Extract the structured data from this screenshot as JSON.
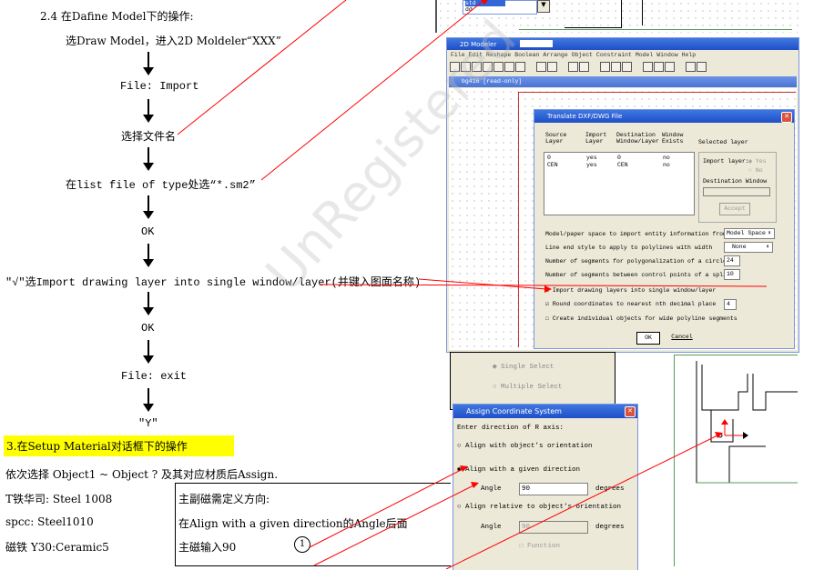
{
  "doc": {
    "section_24_title": "2.4 在Dafine Model下的操作:",
    "flow": [
      "选Draw Model，进入2D Moldeler“XXX”",
      "File: Import",
      "选择文件名",
      "在list file of type处选“*.sm2”",
      "OK",
      "\"√\"选Import drawing layer into single window/layer(并键入图面名称)",
      "OK",
      "File: exit",
      "\"Y\""
    ],
    "section_3_title": "3.在Setup Material对话框下的操作",
    "select_line": "依次选择  Object1  ~  Object ? 及其对应材质后Assign.",
    "materials": [
      "T铁华司: Steel 1008",
      "spcc: Steel1010",
      "磁铁 Y30:Ceramic5"
    ],
    "note_box": [
      "主副磁需定义方向:",
      "在Align with a given direction的Angle后面",
      "主磁输入90"
    ],
    "note_circle": "1",
    "watermark": "UnRegistered"
  },
  "screens": {
    "top_strip": {
      "dd_item1": "std",
      "dd_item2": "dd"
    },
    "modeler": {
      "title": "2D Modeler",
      "menu": "File Edit Reshape Boolean Arrange Object Constraint Model Window Help",
      "doc_tab": "bg416 [read-only]"
    },
    "dxf_dialog": {
      "title": "Translate DXF/DWG File",
      "headers": [
        "Source Layer",
        "Import Layer",
        "Destination Window/Layer",
        "Window Exists",
        "Selected layer"
      ],
      "rows": [
        [
          "0",
          "yes",
          "0",
          "no"
        ],
        [
          "CEN",
          "yes",
          "CEN",
          "no"
        ]
      ],
      "import_layer_label": "Import layer:",
      "yes": "Yes",
      "no": "No",
      "dest_window_label": "Destination Window",
      "accept": "Accept",
      "opt1": "Model/paper space to import entity information from",
      "opt1_val": "Model Space",
      "opt2": "Line end style to apply to polylines with width",
      "opt2_val": "None",
      "opt3": "Number of segments for polygonalization of a circle",
      "opt3_val": "24",
      "opt4": "Number of segments between control points of a spline",
      "opt4_val": "10",
      "chk1": "Import drawing layers into single window/layer",
      "chk2": "Round coordinates to nearest nth decimal place",
      "chk2_val": "4",
      "chk3": "Create individual objects for wide polyline segments",
      "ok": "OK",
      "cancel": "Cancel"
    },
    "select_panel": {
      "single": "Single Select",
      "multiple": "Multiple Select"
    },
    "acs": {
      "title": "Assign Coordinate System",
      "prompt": "Enter direction of R axis:",
      "r1": "Align with object's orientation",
      "r2": "Align with a given direction",
      "angle_label": "Angle",
      "angle_val": "90",
      "degrees": "degrees",
      "r3": "Align relative to object's orientation",
      "angle2_val": "90",
      "function": "Function"
    }
  },
  "colors": {
    "highlight": "#ffff00",
    "arrow_red": "#ff0000",
    "titlebar": "#2456d0"
  }
}
